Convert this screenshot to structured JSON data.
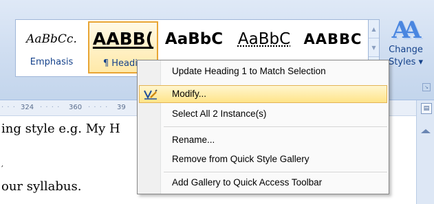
{
  "ribbon": {
    "styles": [
      {
        "sample": "AaBbCc.",
        "name": "Emphasis"
      },
      {
        "sample": "AABB(",
        "name": "¶ Headin"
      },
      {
        "sample": "AaBbC",
        "name": ""
      },
      {
        "sample": "AaBbC",
        "name": ""
      },
      {
        "sample": "AABBC",
        "name": ""
      }
    ],
    "change_styles": {
      "line1": "Change",
      "line2": "Styles ▾"
    }
  },
  "ruler": {
    "label_a": "324",
    "label_b": "360",
    "label_c": "39"
  },
  "document": {
    "line1": "ing style e.g. My H",
    "line2": "our syllabus."
  },
  "context_menu": {
    "items": [
      {
        "label": "Update Heading 1 to Match Selection"
      },
      {
        "label": "Modify...",
        "icon": "modify-style-icon"
      },
      {
        "label": "Select All 2 Instance(s)"
      },
      {
        "label": "Rename..."
      },
      {
        "label": "Remove from Quick Style Gallery"
      },
      {
        "label": "Add Gallery to Quick Access Toolbar"
      }
    ]
  },
  "colors": {
    "highlight": "#ffe489",
    "highlight_border": "#e3b354",
    "ribbon": "#d0def1",
    "accent_text": "#15428b"
  }
}
